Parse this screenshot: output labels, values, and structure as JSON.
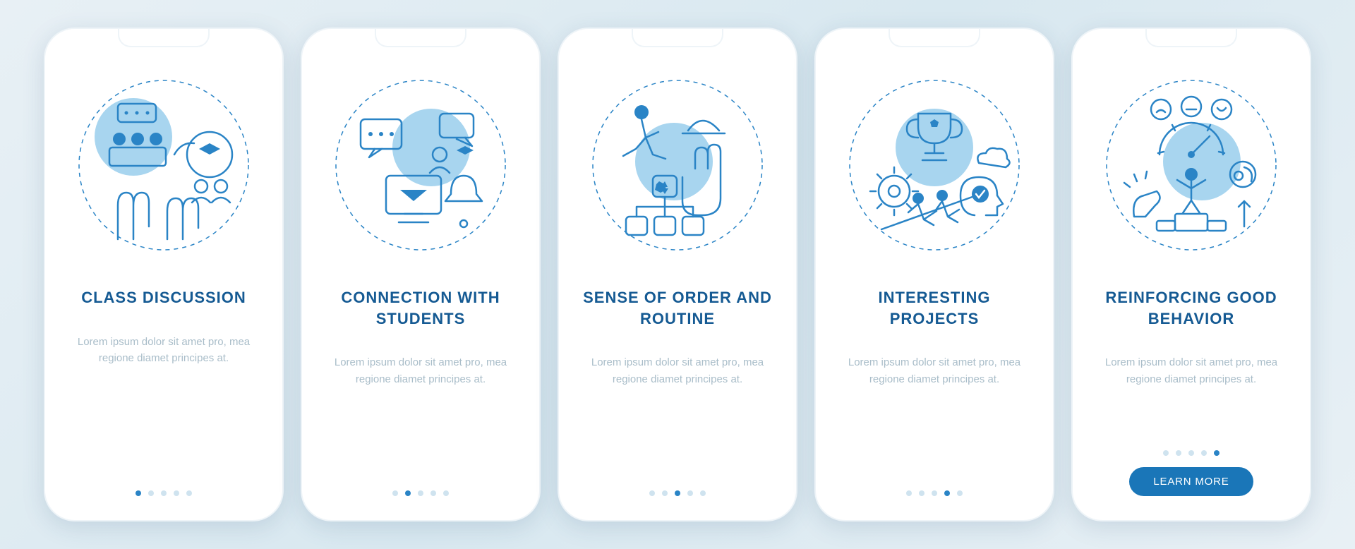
{
  "button_label": "LEARN MORE",
  "body_text": "Lorem ipsum dolor sit amet pro, mea regione diamet principes at.",
  "total_slides": 5,
  "slides": [
    {
      "title": "CLASS DISCUSSION",
      "active_index": 0,
      "has_button": false
    },
    {
      "title": "CONNECTION WITH STUDENTS",
      "active_index": 1,
      "has_button": false
    },
    {
      "title": "SENSE OF ORDER AND ROUTINE",
      "active_index": 2,
      "has_button": false
    },
    {
      "title": "INTERESTING PROJECTS",
      "active_index": 3,
      "has_button": false
    },
    {
      "title": "REINFORCING GOOD BEHAVIOR",
      "active_index": 4,
      "has_button": true
    }
  ],
  "colors": {
    "primary": "#1a76b8",
    "accent": "#2a84c6",
    "light": "#a8d5ef",
    "muted": "#a9bdc9"
  }
}
